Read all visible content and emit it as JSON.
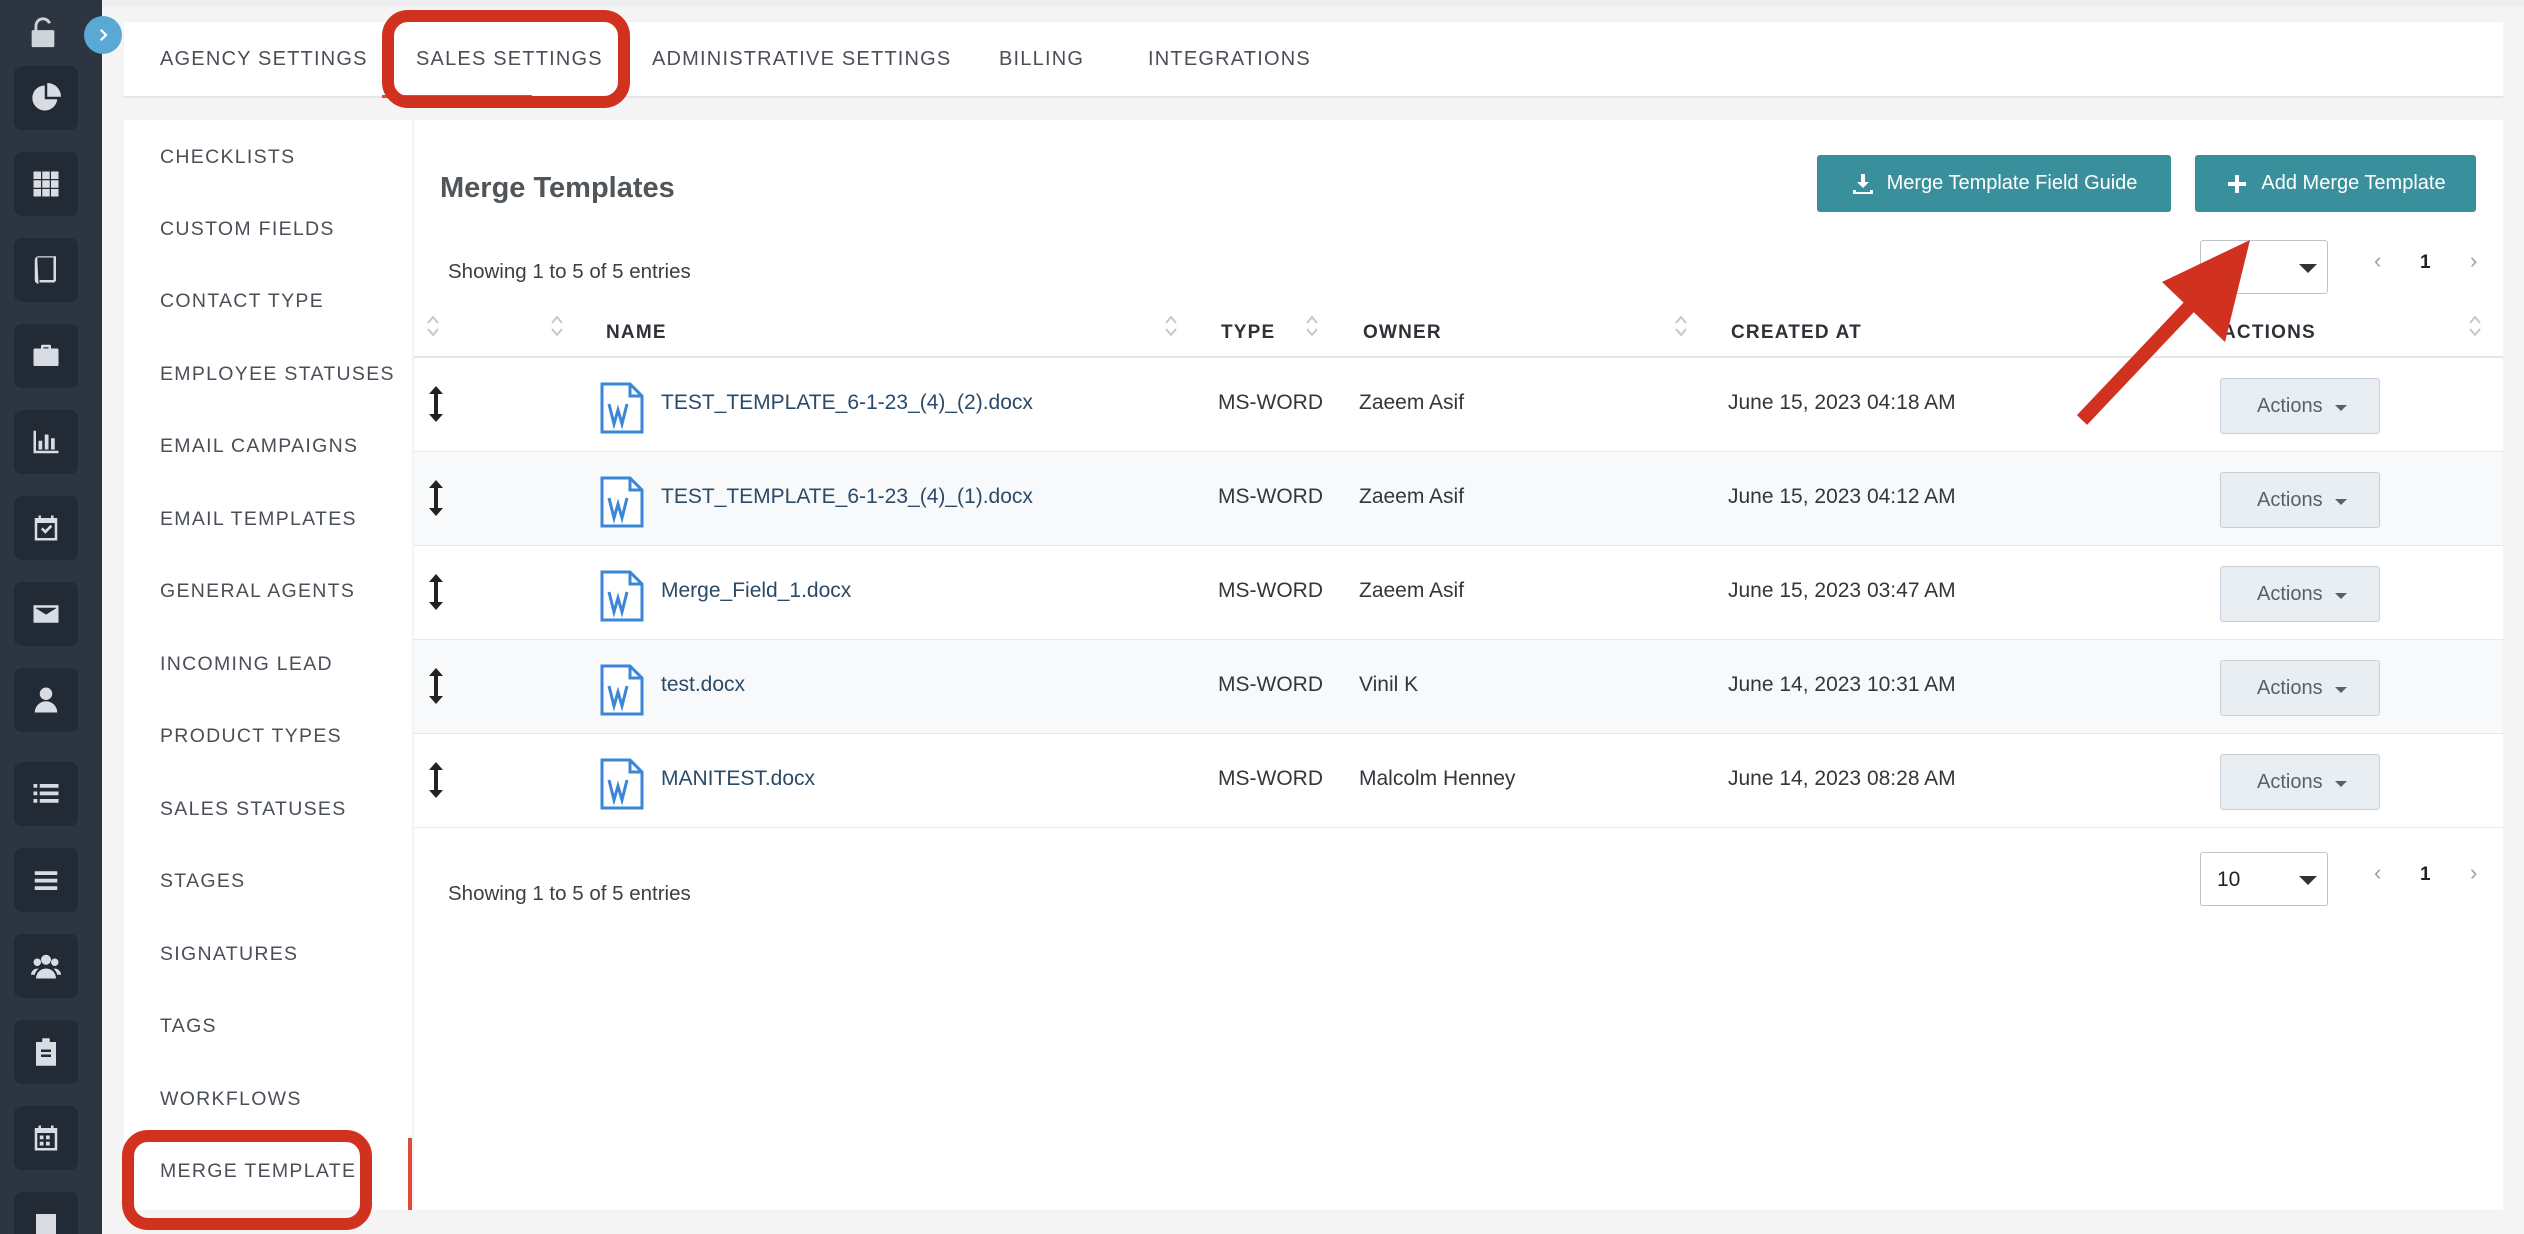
{
  "app": {
    "accent_color": "#e04a3a",
    "button_color": "#3a8f9c",
    "annotation_color": "#d0321f"
  },
  "rail": {
    "icons": [
      "unlock-icon",
      "pie-chart-icon",
      "grid-icon",
      "book-icon",
      "briefcase-icon",
      "bar-chart-icon",
      "calendar-check-icon",
      "envelope-icon",
      "user-icon",
      "list-icon",
      "menu-icon",
      "users-icon",
      "clipboard-icon",
      "calendar-icon"
    ]
  },
  "tabs": [
    {
      "label": "AGENCY SETTINGS"
    },
    {
      "label": "SALES SETTINGS",
      "active": true
    },
    {
      "label": "ADMINISTRATIVE SETTINGS"
    },
    {
      "label": "BILLING"
    },
    {
      "label": "INTEGRATIONS"
    }
  ],
  "sidebar": {
    "items": [
      {
        "label": "CHECKLISTS"
      },
      {
        "label": "CUSTOM FIELDS"
      },
      {
        "label": "CONTACT TYPE"
      },
      {
        "label": "EMPLOYEE STATUSES"
      },
      {
        "label": "EMAIL CAMPAIGNS"
      },
      {
        "label": "EMAIL TEMPLATES"
      },
      {
        "label": "GENERAL AGENTS"
      },
      {
        "label": "INCOMING LEAD"
      },
      {
        "label": "PRODUCT TYPES"
      },
      {
        "label": "SALES STATUSES"
      },
      {
        "label": "STAGES"
      },
      {
        "label": "SIGNATURES"
      },
      {
        "label": "TAGS"
      },
      {
        "label": "WORKFLOWS"
      },
      {
        "label": "MERGE TEMPLATE",
        "active": true
      }
    ]
  },
  "main": {
    "title": "Merge Templates",
    "field_guide_button": "Merge Template Field Guide",
    "add_button": "Add Merge Template",
    "showing_top": "Showing 1 to 5 of 5 entries",
    "showing_bottom": "Showing 1 to 5 of 5 entries",
    "page_size": "10",
    "current_page": "1",
    "columns": {
      "name": "NAME",
      "type": "TYPE",
      "owner": "OWNER",
      "created_at": "CREATED AT",
      "actions": "ACTIONS"
    },
    "rows": [
      {
        "name": "TEST_TEMPLATE_6-1-23_(4)_(2).docx",
        "type": "MS-WORD",
        "owner": "Zaeem Asif",
        "created_at": "June 15, 2023 04:18 AM",
        "action": "Actions"
      },
      {
        "name": "TEST_TEMPLATE_6-1-23_(4)_(1).docx",
        "type": "MS-WORD",
        "owner": "Zaeem Asif",
        "created_at": "June 15, 2023 04:12 AM",
        "action": "Actions"
      },
      {
        "name": "Merge_Field_1.docx",
        "type": "MS-WORD",
        "owner": "Zaeem Asif",
        "created_at": "June 15, 2023 03:47 AM",
        "action": "Actions"
      },
      {
        "name": "test.docx",
        "type": "MS-WORD",
        "owner": "Vinil K",
        "created_at": "June 14, 2023 10:31 AM",
        "action": "Actions"
      },
      {
        "name": "MANITEST.docx",
        "type": "MS-WORD",
        "owner": "Malcolm Henney",
        "created_at": "June 14, 2023 08:28 AM",
        "action": "Actions"
      }
    ]
  }
}
